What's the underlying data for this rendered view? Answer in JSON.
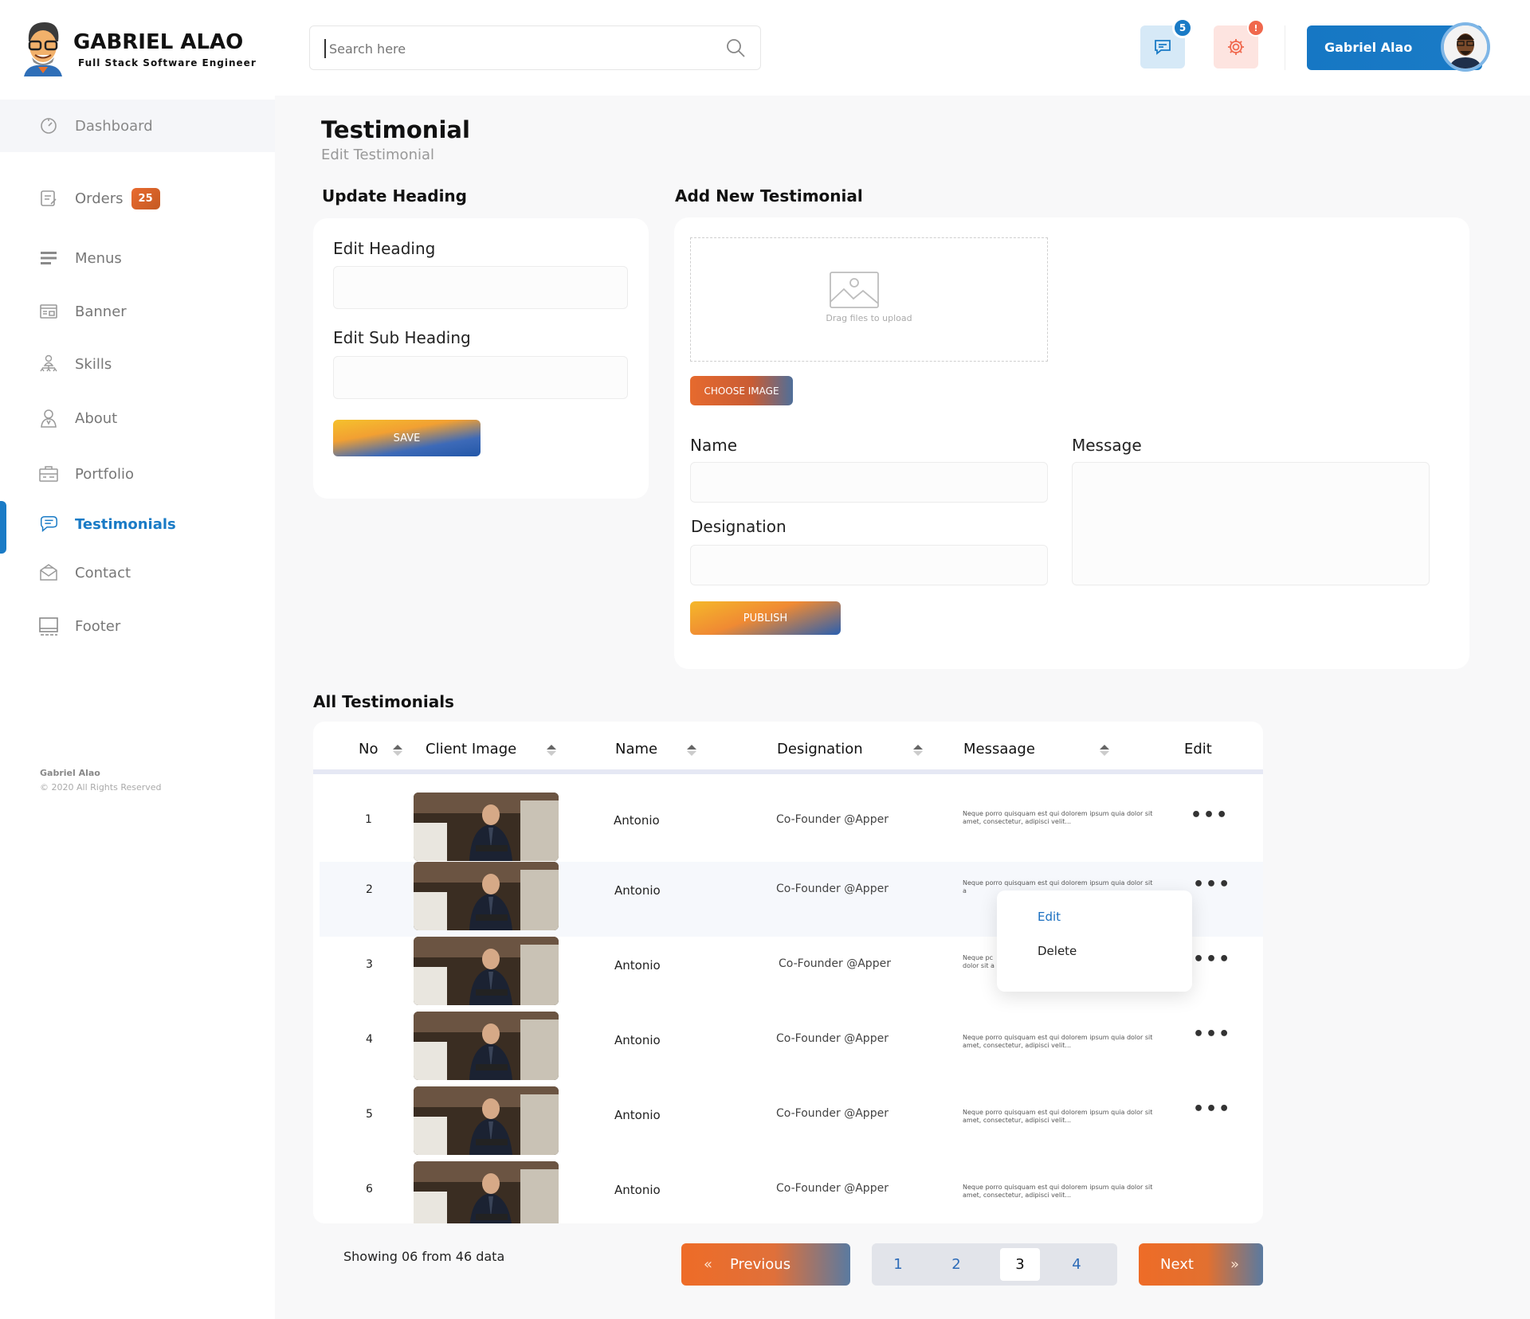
{
  "brand": {
    "name": "GABRIEL ALAO",
    "tagline": "Full Stack Software Engineer"
  },
  "sidebar": {
    "items": [
      {
        "label": "Dashboard",
        "icon": "dashboard-icon"
      },
      {
        "label": "Orders",
        "icon": "orders-icon",
        "badge": "25"
      },
      {
        "label": "Menus",
        "icon": "menus-icon"
      },
      {
        "label": "Banner",
        "icon": "banner-icon"
      },
      {
        "label": "Skills",
        "icon": "skills-icon"
      },
      {
        "label": "About",
        "icon": "about-icon"
      },
      {
        "label": "Portfolio",
        "icon": "portfolio-icon"
      },
      {
        "label": "Testimonials",
        "icon": "testimonials-icon"
      },
      {
        "label": "Contact",
        "icon": "contact-icon"
      },
      {
        "label": "Footer",
        "icon": "footer-icon"
      }
    ],
    "active": "Testimonials",
    "footer_name": "Gabriel Alao",
    "footer_copy": "© 2020 All Rights Reserved"
  },
  "header": {
    "search_placeholder": "Search here",
    "chat_count": "5",
    "alert_mark": "!",
    "user_name": "Gabriel Alao"
  },
  "page": {
    "title": "Testimonial",
    "subtitle": "Edit Testimonial"
  },
  "heading_form": {
    "section_title": "Update Heading",
    "heading_label": "Edit Heading",
    "heading_value": "",
    "subheading_label": "Edit Sub Heading",
    "subheading_value": "",
    "save_label": "SAVE"
  },
  "new_form": {
    "section_title": "Add New Testimonial",
    "drop_text": "Drag files to upload",
    "choose_label": "CHOOSE IMAGE",
    "name_label": "Name",
    "name_value": "",
    "message_label": "Message",
    "message_value": "",
    "designation_label": "Designation",
    "designation_value": "",
    "publish_label": "PUBLISH"
  },
  "table": {
    "section_title": "All Testimonials",
    "columns": [
      "No",
      "Client Image",
      "Name",
      "Designation",
      "Messaage",
      "Edit"
    ],
    "rows": [
      {
        "no": "1",
        "name": "Antonio",
        "designation": "Co-Founder @Apper",
        "message": "Neque porro quisquam est qui dolorem ipsum quia dolor sit amet, consectetur, adipisci velit..."
      },
      {
        "no": "2",
        "name": "Antonio",
        "designation": "Co-Founder @Apper",
        "message": "Neque porro quisquam est qui dolorem ipsum quia dolor sit a"
      },
      {
        "no": "3",
        "name": "Antonio",
        "designation": "Co-Founder @Apper",
        "message": "Neque pc dolor sit a"
      },
      {
        "no": "4",
        "name": "Antonio",
        "designation": "Co-Founder @Apper",
        "message": "Neque porro quisquam est qui dolorem ipsum quia dolor sit amet, consectetur, adipisci velit..."
      },
      {
        "no": "5",
        "name": "Antonio",
        "designation": "Co-Founder @Apper",
        "message": "Neque porro quisquam est qui dolorem ipsum quia dolor sit amet, consectetur, adipisci velit..."
      },
      {
        "no": "6",
        "name": "Antonio",
        "designation": "Co-Founder @Apper",
        "message": "Neque porro quisquam est qui dolorem ipsum quia dolor sit amet, consectetur, adipisci velit..."
      }
    ],
    "row_menu": {
      "edit": "Edit",
      "delete": "Delete"
    }
  },
  "pagination": {
    "showing": "Showing 06 from 46 data",
    "prev_label": "Previous",
    "next_label": "Next",
    "pages": [
      "1",
      "2",
      "3",
      "4"
    ],
    "current": "3"
  },
  "colors": {
    "accent": "#1a7bc6",
    "orange": "#ee6c27",
    "yellow": "#f5c12d"
  }
}
